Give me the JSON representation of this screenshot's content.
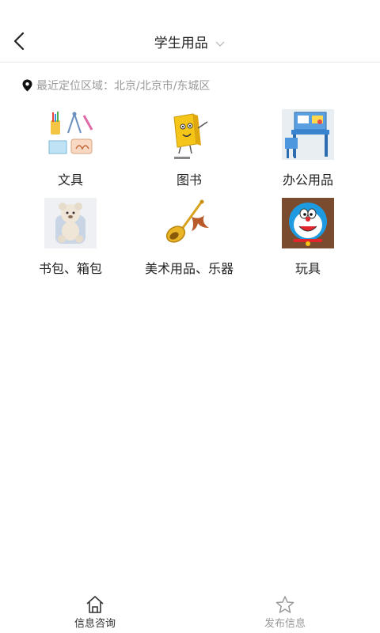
{
  "header": {
    "title": "学生用品"
  },
  "location": {
    "label": "最近定位区域：",
    "value": "北京/北京市/东城区"
  },
  "categories": [
    {
      "label": "文具",
      "icon": "stationery-image"
    },
    {
      "label": "图书",
      "icon": "book-image"
    },
    {
      "label": "办公用品",
      "icon": "desk-image"
    },
    {
      "label": "书包、箱包",
      "icon": "backpack-image"
    },
    {
      "label": "美术用品、乐器",
      "icon": "trumpet-image"
    },
    {
      "label": "玩具",
      "icon": "doraemon-toy-image"
    }
  ],
  "tabbar": {
    "tabs": [
      {
        "label": "信息咨询",
        "icon": "home-icon",
        "active": true
      },
      {
        "label": "发布信息",
        "icon": "star-icon",
        "active": false
      }
    ]
  }
}
